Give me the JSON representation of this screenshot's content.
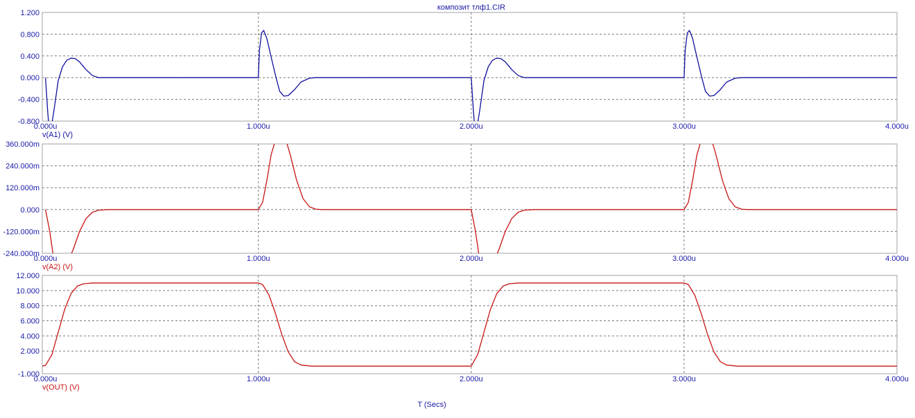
{
  "chart_data": {
    "type": "line",
    "title": "композит тлф1.CIR",
    "xlabel": "T (Secs)",
    "x_tick_labels": [
      "0.000u",
      "1.000u",
      "2.000u",
      "3.000u",
      "4.000u"
    ],
    "x_ticks": [
      0,
      1,
      2,
      3,
      4
    ],
    "xlim": [
      -0.015,
      4.0
    ],
    "grid": true,
    "panels": [
      {
        "series": [
          {
            "name": "v(A1) (V)",
            "color": "#1010a0"
          }
        ],
        "ylim": [
          -0.8,
          1.2
        ],
        "y_ticks": [
          -0.8,
          -0.4,
          0.0,
          0.4,
          0.8,
          1.2
        ],
        "y_tick_labels": [
          "-0.800",
          "-0.400",
          "0.000",
          "0.400",
          "0.800",
          "1.200"
        ],
        "points": [
          [
            0.0,
            0.0
          ],
          [
            0.01,
            -0.6
          ],
          [
            0.02,
            -1.1
          ],
          [
            0.04,
            -0.6
          ],
          [
            0.06,
            -0.05
          ],
          [
            0.08,
            0.2
          ],
          [
            0.1,
            0.32
          ],
          [
            0.12,
            0.36
          ],
          [
            0.14,
            0.35
          ],
          [
            0.16,
            0.29
          ],
          [
            0.19,
            0.15
          ],
          [
            0.22,
            0.04
          ],
          [
            0.25,
            0.0
          ],
          [
            1.0,
            0.0
          ],
          [
            1.005,
            0.5
          ],
          [
            1.015,
            0.82
          ],
          [
            1.025,
            0.87
          ],
          [
            1.04,
            0.72
          ],
          [
            1.06,
            0.38
          ],
          [
            1.08,
            0.05
          ],
          [
            1.1,
            -0.25
          ],
          [
            1.12,
            -0.34
          ],
          [
            1.14,
            -0.33
          ],
          [
            1.17,
            -0.22
          ],
          [
            1.2,
            -0.08
          ],
          [
            1.24,
            -0.01
          ],
          [
            1.27,
            0.0
          ],
          [
            2.0,
            0.0
          ],
          [
            2.01,
            -0.6
          ],
          [
            2.02,
            -1.1
          ],
          [
            2.04,
            -0.6
          ],
          [
            2.06,
            -0.05
          ],
          [
            2.08,
            0.2
          ],
          [
            2.1,
            0.32
          ],
          [
            2.12,
            0.36
          ],
          [
            2.14,
            0.35
          ],
          [
            2.16,
            0.29
          ],
          [
            2.19,
            0.15
          ],
          [
            2.22,
            0.04
          ],
          [
            2.25,
            0.0
          ],
          [
            3.0,
            0.0
          ],
          [
            3.005,
            0.5
          ],
          [
            3.015,
            0.82
          ],
          [
            3.025,
            0.87
          ],
          [
            3.04,
            0.72
          ],
          [
            3.06,
            0.38
          ],
          [
            3.08,
            0.05
          ],
          [
            3.1,
            -0.25
          ],
          [
            3.12,
            -0.34
          ],
          [
            3.14,
            -0.33
          ],
          [
            3.17,
            -0.22
          ],
          [
            3.2,
            -0.08
          ],
          [
            3.24,
            -0.01
          ],
          [
            3.27,
            0.0
          ],
          [
            4.0,
            0.0
          ]
        ]
      },
      {
        "series": [
          {
            "name": "v(A2) (V)",
            "color": "#c81414"
          }
        ],
        "ylim": [
          -0.24,
          0.36
        ],
        "y_ticks": [
          -0.24,
          -0.12,
          0.0,
          0.12,
          0.24,
          0.36
        ],
        "y_tick_labels": [
          "-240.000m",
          "-120.000m",
          "0.000",
          "120.000m",
          "240.000m",
          "360.000m"
        ],
        "points": [
          [
            0.0,
            0.0
          ],
          [
            0.02,
            -0.12
          ],
          [
            0.04,
            -0.28
          ],
          [
            0.07,
            -0.34
          ],
          [
            0.1,
            -0.3
          ],
          [
            0.13,
            -0.22
          ],
          [
            0.16,
            -0.12
          ],
          [
            0.19,
            -0.05
          ],
          [
            0.22,
            -0.015
          ],
          [
            0.25,
            -0.003
          ],
          [
            0.3,
            0.0
          ],
          [
            1.0,
            0.0
          ],
          [
            1.02,
            0.04
          ],
          [
            1.04,
            0.16
          ],
          [
            1.06,
            0.3
          ],
          [
            1.09,
            0.42
          ],
          [
            1.12,
            0.42
          ],
          [
            1.15,
            0.3
          ],
          [
            1.18,
            0.16
          ],
          [
            1.21,
            0.06
          ],
          [
            1.24,
            0.015
          ],
          [
            1.27,
            0.002
          ],
          [
            1.3,
            0.0
          ],
          [
            2.0,
            0.0
          ],
          [
            2.02,
            -0.12
          ],
          [
            2.04,
            -0.28
          ],
          [
            2.07,
            -0.34
          ],
          [
            2.1,
            -0.3
          ],
          [
            2.13,
            -0.22
          ],
          [
            2.16,
            -0.12
          ],
          [
            2.19,
            -0.05
          ],
          [
            2.22,
            -0.015
          ],
          [
            2.25,
            -0.003
          ],
          [
            2.3,
            0.0
          ],
          [
            3.0,
            0.0
          ],
          [
            3.02,
            0.04
          ],
          [
            3.04,
            0.16
          ],
          [
            3.06,
            0.3
          ],
          [
            3.09,
            0.42
          ],
          [
            3.12,
            0.42
          ],
          [
            3.15,
            0.3
          ],
          [
            3.18,
            0.16
          ],
          [
            3.21,
            0.06
          ],
          [
            3.24,
            0.015
          ],
          [
            3.27,
            0.002
          ],
          [
            3.3,
            0.0
          ],
          [
            4.0,
            0.0
          ]
        ]
      },
      {
        "series": [
          {
            "name": "v(OUT) (V)",
            "color": "#c81414"
          }
        ],
        "ylim": [
          -1.0,
          12.0
        ],
        "y_ticks": [
          -1.0,
          2.0,
          4.0,
          6.0,
          8.0,
          10.0,
          12.0
        ],
        "y_tick_labels": [
          "-1.000",
          "2.000",
          "4.000",
          "6.000",
          "8.000",
          "10.000",
          "12.000"
        ],
        "points": [
          [
            -0.015,
            0.0
          ],
          [
            0.0,
            0.1
          ],
          [
            0.03,
            1.5
          ],
          [
            0.06,
            4.5
          ],
          [
            0.09,
            7.5
          ],
          [
            0.12,
            9.6
          ],
          [
            0.15,
            10.6
          ],
          [
            0.18,
            10.9
          ],
          [
            0.22,
            11.0
          ],
          [
            1.0,
            11.0
          ],
          [
            1.02,
            10.8
          ],
          [
            1.05,
            9.4
          ],
          [
            1.08,
            7.0
          ],
          [
            1.11,
            4.2
          ],
          [
            1.14,
            1.9
          ],
          [
            1.17,
            0.6
          ],
          [
            1.2,
            0.15
          ],
          [
            1.25,
            0.0
          ],
          [
            2.0,
            0.0
          ],
          [
            2.03,
            1.5
          ],
          [
            2.06,
            4.5
          ],
          [
            2.09,
            7.5
          ],
          [
            2.12,
            9.6
          ],
          [
            2.15,
            10.6
          ],
          [
            2.18,
            10.9
          ],
          [
            2.22,
            11.0
          ],
          [
            3.0,
            11.0
          ],
          [
            3.02,
            10.8
          ],
          [
            3.05,
            9.4
          ],
          [
            3.08,
            7.0
          ],
          [
            3.11,
            4.2
          ],
          [
            3.14,
            1.9
          ],
          [
            3.17,
            0.6
          ],
          [
            3.2,
            0.15
          ],
          [
            3.25,
            0.0
          ],
          [
            4.0,
            0.0
          ]
        ]
      }
    ]
  }
}
